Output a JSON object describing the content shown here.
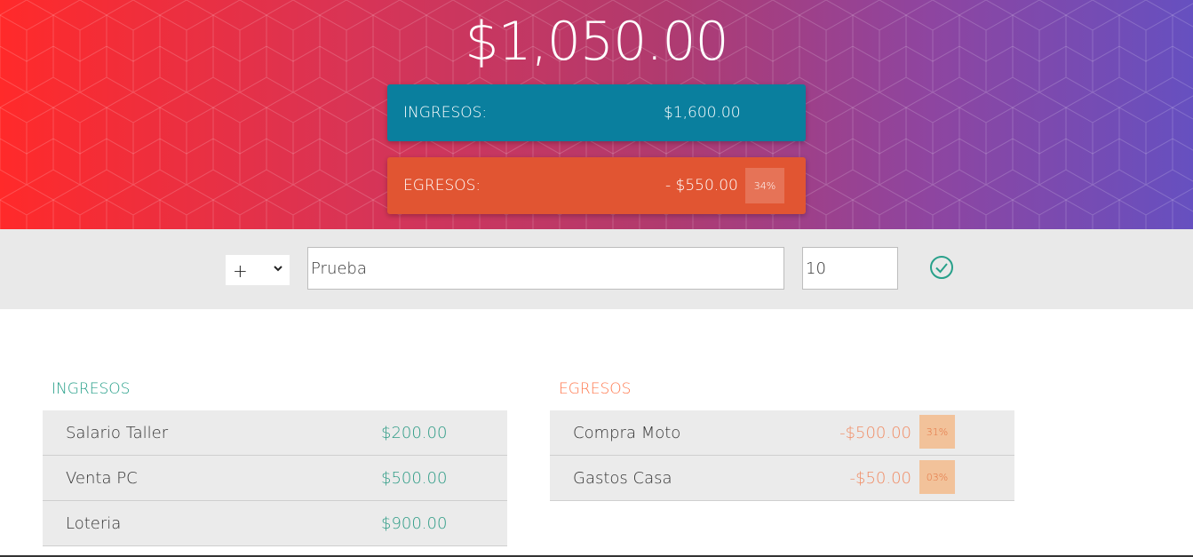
{
  "budget": {
    "total": "$1,050.00",
    "income_label": "INGRESOS:",
    "income_value": "$1,600.00",
    "expense_label": "EGRESOS:",
    "expense_value": "- $550.00",
    "expense_percentage": "34%"
  },
  "add_form": {
    "type_value": "+",
    "description_value": "Prueba",
    "amount_value": "10",
    "submit_icon": "check-circle-icon"
  },
  "income": {
    "title": "INGRESOS",
    "items": [
      {
        "description": "Salario Taller",
        "value": "$200.00"
      },
      {
        "description": "Venta PC",
        "value": "$500.00"
      },
      {
        "description": "Loteria",
        "value": "$900.00"
      }
    ]
  },
  "expenses": {
    "title": "EGRESOS",
    "items": [
      {
        "description": "Compra Moto",
        "value": "-$500.00",
        "percentage": "31%"
      },
      {
        "description": "Gastos Casa",
        "value": "-$50.00",
        "percentage": "03%"
      }
    ]
  },
  "colors": {
    "income_card": "#0a7f9e",
    "expense_card": "#e15532",
    "income_text": "#2f9c86",
    "expense_text": "#f08d66"
  }
}
